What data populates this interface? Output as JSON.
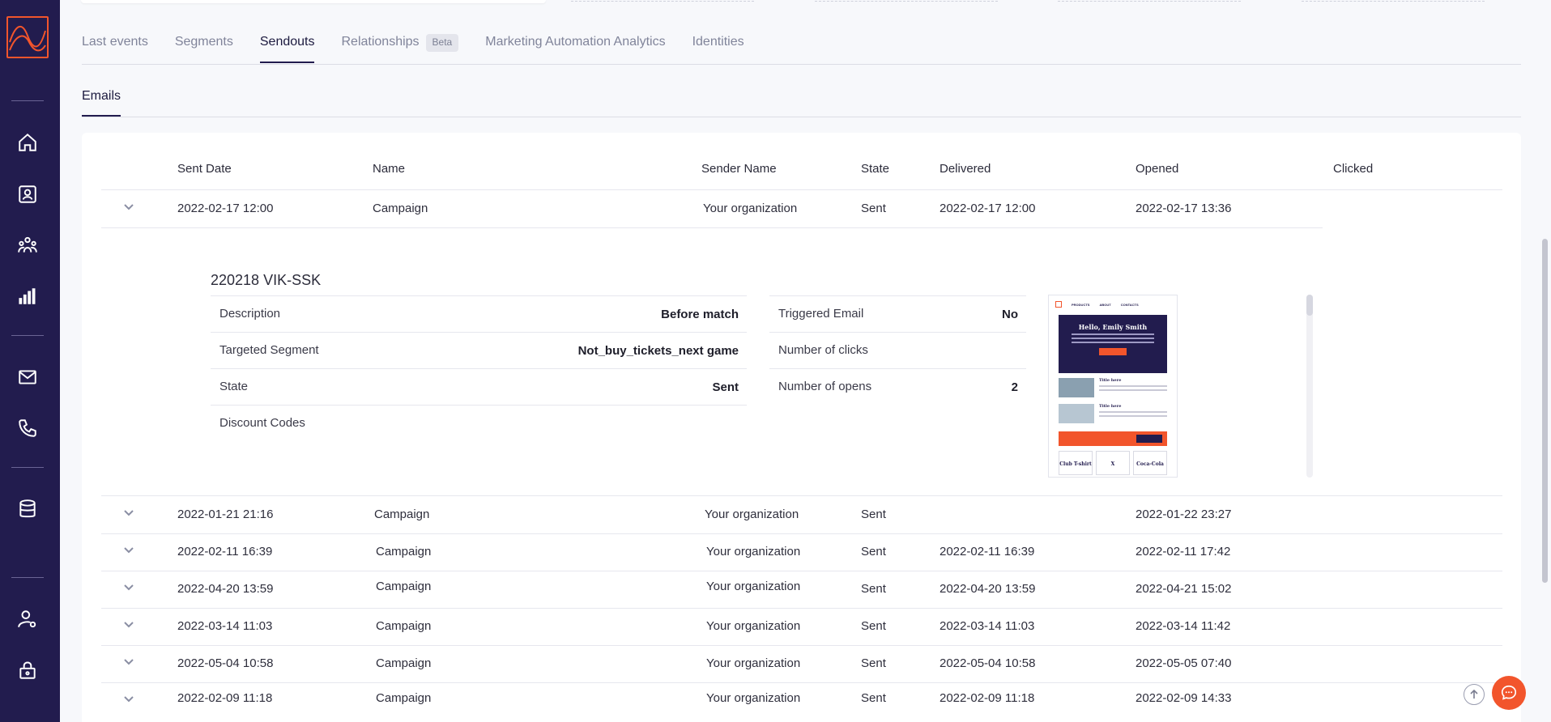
{
  "nav": {
    "icons": [
      "logo-icon",
      "home-icon",
      "contact-icon",
      "audience-icon",
      "analytics-icon",
      "email-icon",
      "phone-icon",
      "database-icon",
      "user-settings-icon",
      "lock-icon"
    ]
  },
  "tabs": [
    {
      "label": "Last events"
    },
    {
      "label": "Segments"
    },
    {
      "label": "Sendouts"
    },
    {
      "label": "Relationships",
      "badge": "Beta"
    },
    {
      "label": "Marketing Automation Analytics"
    },
    {
      "label": "Identities"
    }
  ],
  "active_tab": "Sendouts",
  "subtabs": [
    {
      "label": "Emails"
    }
  ],
  "table": {
    "headers": [
      "Sent Date",
      "Name",
      "Sender Name",
      "State",
      "Delivered",
      "Opened",
      "Clicked"
    ],
    "rows": [
      {
        "sent": "2022-02-17 12:00",
        "name": "Campaign",
        "sender": "Your organization",
        "state": "Sent",
        "delivered": "2022-02-17 12:00",
        "opened": "2022-02-17 13:36",
        "clicked": ""
      },
      {
        "sent": "2022-01-21 21:16",
        "name": "Campaign",
        "sender": "Your organization",
        "state": "Sent",
        "delivered": "",
        "opened": "2022-01-22 23:27",
        "clicked": ""
      },
      {
        "sent": "2022-02-11 16:39",
        "name": "Campaign",
        "sender": "Your organization",
        "state": "Sent",
        "delivered": "2022-02-11 16:39",
        "opened": "2022-02-11 17:42",
        "clicked": ""
      },
      {
        "sent": "2022-04-20 13:59",
        "name": "Campaign",
        "sender": "Your organization",
        "state": "Sent",
        "delivered": "2022-04-20 13:59",
        "opened": "2022-04-21 15:02",
        "clicked": ""
      },
      {
        "sent": "2022-03-14 11:03",
        "name": "Campaign",
        "sender": "Your organization",
        "state": "Sent",
        "delivered": "2022-03-14 11:03",
        "opened": "2022-03-14 11:42",
        "clicked": ""
      },
      {
        "sent": "2022-05-04 10:58",
        "name": "Campaign",
        "sender": "Your organization",
        "state": "Sent",
        "delivered": "2022-05-04 10:58",
        "opened": "2022-05-05 07:40",
        "clicked": ""
      },
      {
        "sent": "2022-02-09 11:18",
        "name": "Campaign",
        "sender": "Your organization",
        "state": "Sent",
        "delivered": "2022-02-09 11:18",
        "opened": "2022-02-09 14:33",
        "clicked": ""
      }
    ]
  },
  "detail": {
    "title": "220218 VIK-SSK",
    "left": [
      {
        "key": "Description",
        "value": "Before match"
      },
      {
        "key": "Targeted Segment",
        "value": "Not_buy_tickets_next game"
      },
      {
        "key": "State",
        "value": "Sent"
      },
      {
        "key": "Discount Codes",
        "value": ""
      }
    ],
    "right": [
      {
        "key": "Triggered Email",
        "value": "No"
      },
      {
        "key": "Number of clicks",
        "value": ""
      },
      {
        "key": "Number of opens",
        "value": "2"
      }
    ],
    "preview": {
      "nav": [
        "PRODUCTS",
        "ABOUT",
        "CONTACTS"
      ],
      "hero_title": "Hello, Emily Smith",
      "item_title": "Title here",
      "cards": [
        "Club T-shirt",
        "X",
        "Coca-Cola"
      ]
    }
  },
  "colors": {
    "sidebar": "#221c4e",
    "accent": "#f2552c",
    "text": "#2b2b3a"
  }
}
